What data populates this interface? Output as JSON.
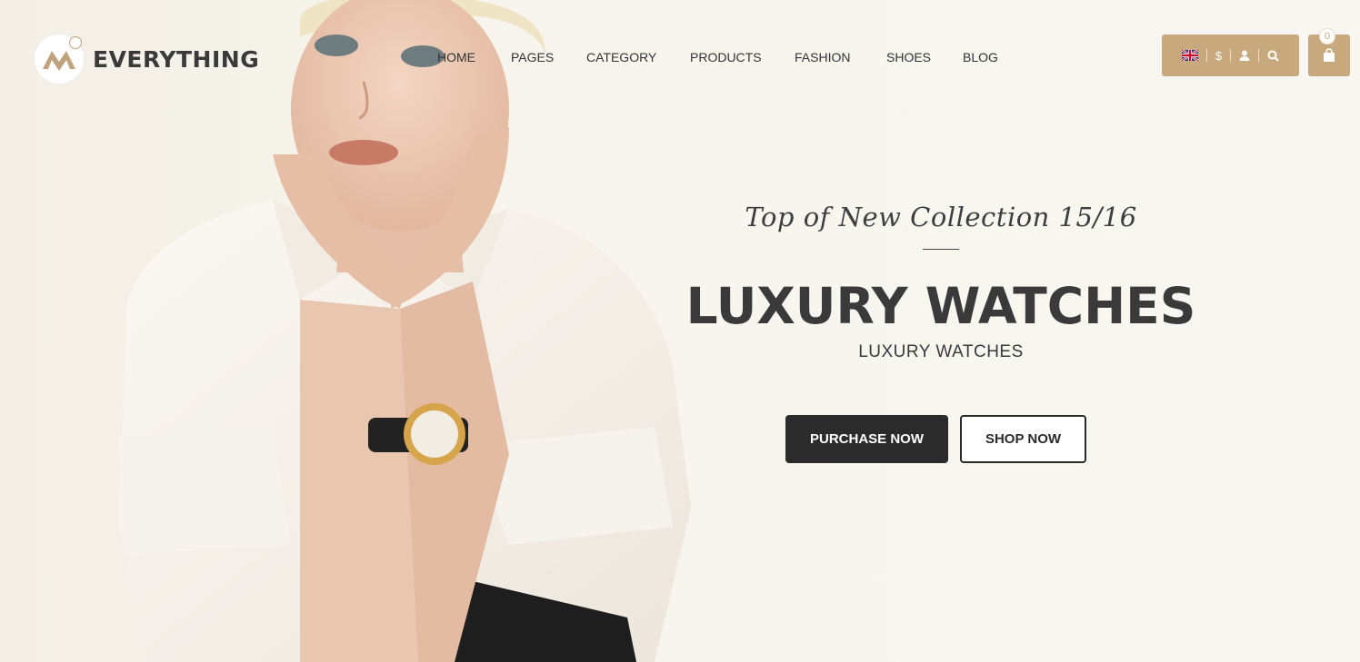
{
  "brand": {
    "name": "EVERYTHING",
    "accent": "#c8a97e"
  },
  "nav": {
    "items": [
      {
        "label": "HOME"
      },
      {
        "label": "PAGES"
      },
      {
        "label": "CATEGORY"
      },
      {
        "label": "PRODUCTS"
      },
      {
        "label": "FASHION"
      },
      {
        "label": "SHOES"
      },
      {
        "label": "BLOG"
      }
    ]
  },
  "toolbar": {
    "language_icon": "uk-flag-icon",
    "currency": "$",
    "account_icon": "user-icon",
    "search_icon": "search-icon"
  },
  "cart": {
    "count": "0",
    "icon": "shopping-bag-icon"
  },
  "hero": {
    "tagline": "Top of New Collection 15/16",
    "headline": "LUXURY WATCHES",
    "subline": "LUXURY WATCHES",
    "primary_button": "PURCHASE NOW",
    "secondary_button": "SHOP NOW"
  }
}
